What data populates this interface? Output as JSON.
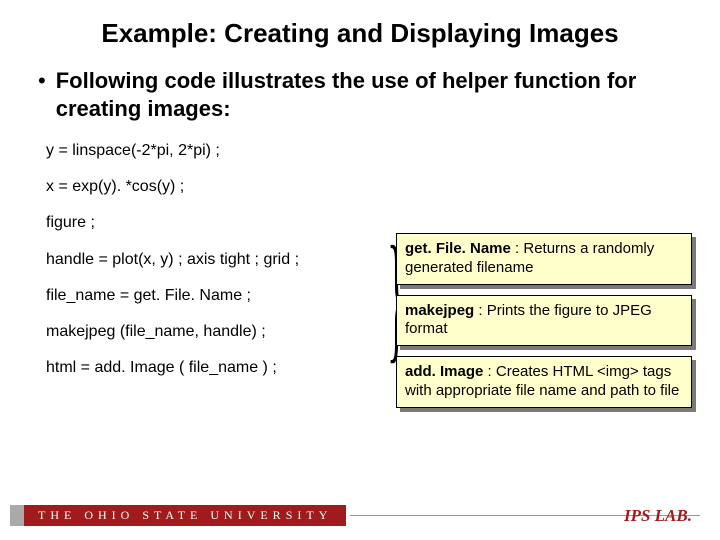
{
  "title": "Example: Creating and Displaying Images",
  "bullet": "Following code illustrates the use of helper function for creating images:",
  "code": {
    "l1": "y = linspace(-2*pi, 2*pi) ;",
    "l2": "x = exp(y). *cos(y) ;",
    "l3": "figure ;",
    "l4": "handle = plot(x, y) ; axis tight ; grid ;",
    "l5": "file_name = get. File. Name ;",
    "l6": "makejpeg (file_name, handle) ;",
    "l7": "html = add. Image ( file_name ) ;"
  },
  "notes": {
    "n1_b": "get. File. Name",
    "n1_t": " : Returns a randomly generated filename",
    "n2_b": "makejpeg",
    "n2_t": " : Prints the figure to JPEG format",
    "n3_b": "add. Image",
    "n3_t": " : Creates HTML <img> tags with appropriate file name and path to file"
  },
  "footer": {
    "university": "THE OHIO STATE UNIVERSITY",
    "lab": "IPS LAB."
  }
}
